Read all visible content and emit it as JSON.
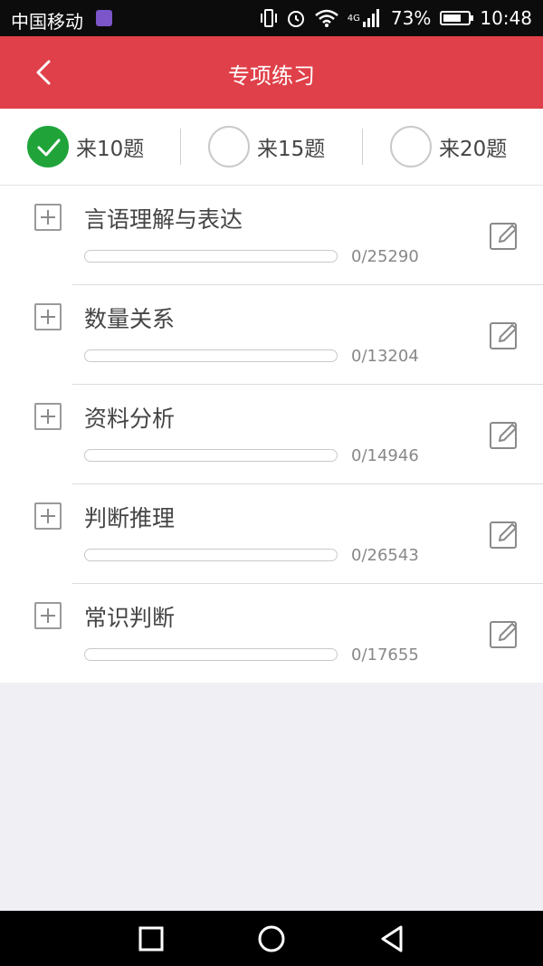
{
  "status_bar": {
    "carrier": "中国移动",
    "network": "4G",
    "battery_text": "73%",
    "battery_level": 0.73,
    "time": "10:48"
  },
  "app_bar": {
    "title": "专项练习",
    "back_icon": "chevron-left-icon"
  },
  "tabs": [
    {
      "label": "来10题",
      "selected": true
    },
    {
      "label": "来15题",
      "selected": false
    },
    {
      "label": "来20题",
      "selected": false
    }
  ],
  "categories": [
    {
      "name": "言语理解与表达",
      "progress_text": "0/25290",
      "progress": 0
    },
    {
      "name": "数量关系",
      "progress_text": "0/13204",
      "progress": 0
    },
    {
      "name": "资料分析",
      "progress_text": "0/14946",
      "progress": 0
    },
    {
      "name": "判断推理",
      "progress_text": "0/26543",
      "progress": 0
    },
    {
      "name": "常识判断",
      "progress_text": "0/17655",
      "progress": 0
    }
  ],
  "colors": {
    "accent": "#e04049",
    "selected": "#20a43a",
    "background": "#efeff4"
  }
}
